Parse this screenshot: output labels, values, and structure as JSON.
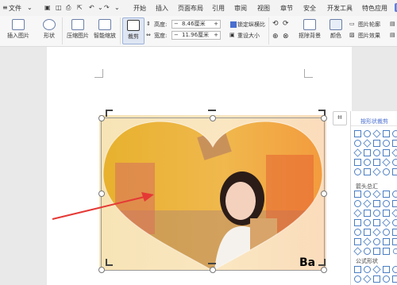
{
  "menubar": {
    "hamburger_label": "文件",
    "tabs": [
      "开始",
      "插入",
      "页面布局",
      "引用",
      "审阅",
      "视图",
      "章节",
      "安全",
      "开发工具",
      "特色应用"
    ]
  },
  "ribbon": {
    "insert_picture": "插入图片",
    "shape": "形状",
    "compress_picture": "压缩图片",
    "smart_zoom": "智能缩放",
    "crop": "裁剪",
    "height_label": "高度:",
    "height_value": "8.46厘米",
    "width_label": "宽度:",
    "width_value": "11.96厘米",
    "lock_ratio": "锁定纵横比",
    "reset_size": "重设大小",
    "remove_bg": "抠除背景",
    "color": "颜色",
    "picture_outline": "图片轮廓",
    "picture_effect": "图片效果"
  },
  "panel": {
    "crop_by_shape": "按形状裁剪",
    "arrows_section": "箭头总汇",
    "formula_section": "公式形状"
  },
  "watermark": "Ba",
  "colors": {
    "accent": "#5a7ee0",
    "shape_stroke": "#4a7ec4",
    "arrow": "#e53935"
  }
}
